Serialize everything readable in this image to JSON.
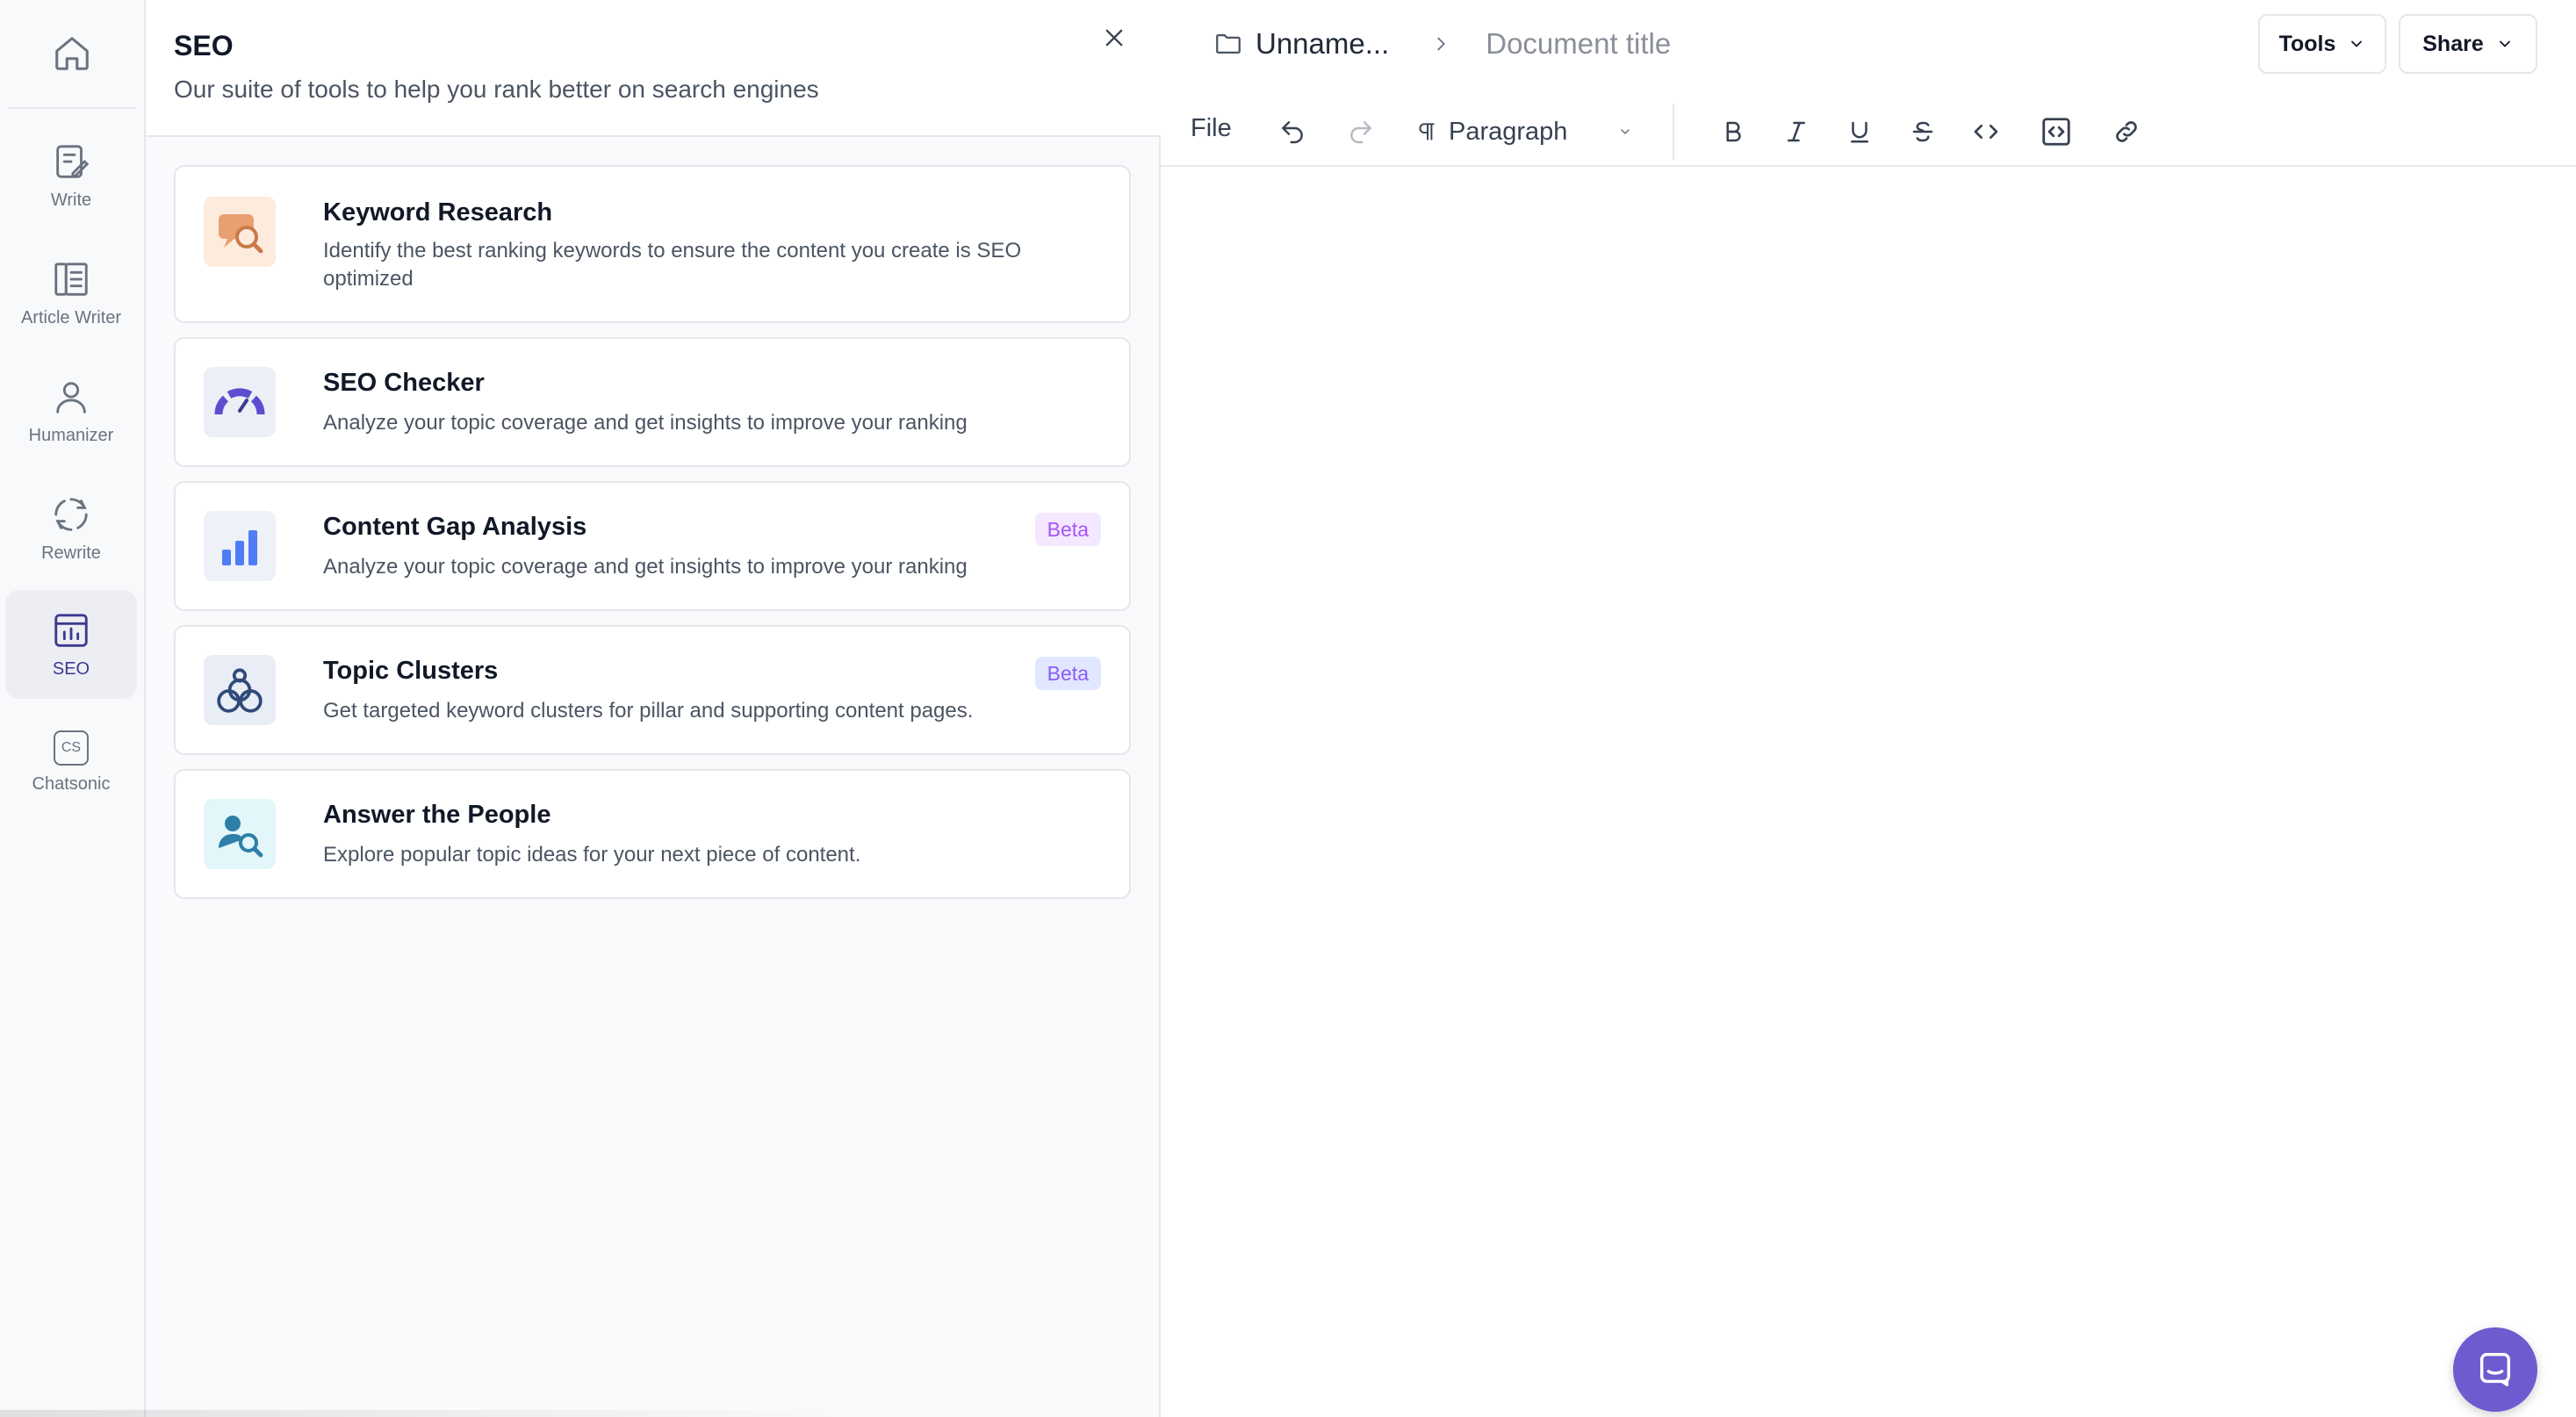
{
  "rail": {
    "items": [
      {
        "label": "Write",
        "icon": "write-icon"
      },
      {
        "label": "Article Writer",
        "icon": "article-icon"
      },
      {
        "label": "Humanizer",
        "icon": "user-icon"
      },
      {
        "label": "Rewrite",
        "icon": "rewrite-icon"
      },
      {
        "label": "SEO",
        "icon": "seo-icon",
        "active": true
      },
      {
        "label": "Chatsonic",
        "icon": "chatsonic-icon",
        "glyph": "CS"
      }
    ]
  },
  "panel": {
    "title": "SEO",
    "subtitle": "Our suite of tools to help you rank better on search engines",
    "cards": [
      {
        "title": "Keyword Research",
        "description": "Identify the best ranking keywords to ensure the content you create is SEO optimized",
        "icon": "keyword-research-icon",
        "icon_bg": "#fdebdd"
      },
      {
        "title": "SEO Checker",
        "description": "Analyze your topic coverage and get insights to improve your ranking",
        "icon": "gauge-icon",
        "icon_bg": "#eceff5"
      },
      {
        "title": "Content Gap Analysis",
        "description": "Analyze your topic coverage and get insights to improve your ranking",
        "icon": "bar-chart-icon",
        "icon_bg": "#eef1f8",
        "badge": "Beta"
      },
      {
        "title": "Topic Clusters",
        "description": "Get targeted keyword clusters for pillar and supporting content pages.",
        "icon": "clusters-icon",
        "icon_bg": "#e9edf5",
        "badge": "Beta"
      },
      {
        "title": "Answer the People",
        "description": "Explore popular topic ideas for your next piece of content.",
        "icon": "people-search-icon",
        "icon_bg": "#e3f6fa"
      }
    ]
  },
  "editor": {
    "breadcrumb_project": "Unname...",
    "document_title": "Document title",
    "tools_label": "Tools",
    "share_label": "Share",
    "toolbar": {
      "file_label": "File",
      "paragraph_label": "Paragraph"
    }
  },
  "colors": {
    "accent": "#3b3b8f",
    "fab": "#6d5bd0",
    "badge_text": "#a855f7",
    "badge_bg": "#f3e8ff"
  }
}
